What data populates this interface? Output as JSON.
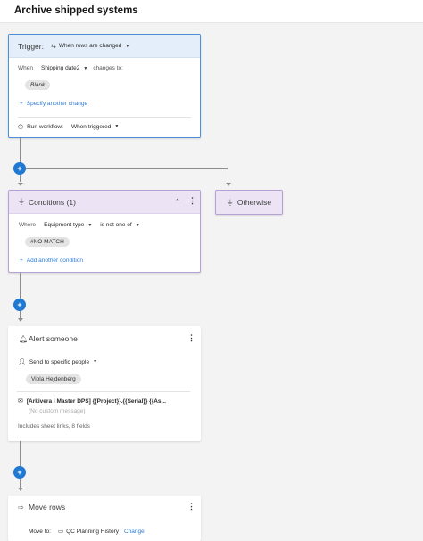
{
  "header": {
    "title": "Archive shipped systems"
  },
  "trigger": {
    "label": "Trigger:",
    "event_value": "When rows are changed",
    "when_label": "When",
    "field_value": "Shipping date2",
    "changes_to_label": "changes to:",
    "blank_chip": "Blank",
    "specify_link": "Specify another change",
    "run_label": "Run workflow:",
    "run_value": "When triggered"
  },
  "conditions": {
    "title": "Conditions (1)",
    "where_label": "Where",
    "field_value": "Equipment type",
    "operator_value": "is not one of",
    "value_chip": "#NO MATCH",
    "add_link": "Add another condition"
  },
  "otherwise": {
    "label": "Otherwise"
  },
  "alert": {
    "title": "Alert someone",
    "send_to_value": "Send to specific people",
    "person_chip": "Viola Hejdenberg",
    "subject": "[Arkivera i Master DPS] {{Project}}.{{Serial}} {{As...",
    "message_placeholder": "(No custom message)",
    "includes": "Includes sheet links, 8 fields"
  },
  "move": {
    "title": "Move rows",
    "move_to_label": "Move to:",
    "sheet_name": "QC Planning History",
    "change_link": "Change"
  },
  "colors": {
    "accent": "#1f78d1",
    "trigger_border": "#4a90d9",
    "condition_border": "#b6a0d4",
    "link": "#2f7cd6"
  }
}
